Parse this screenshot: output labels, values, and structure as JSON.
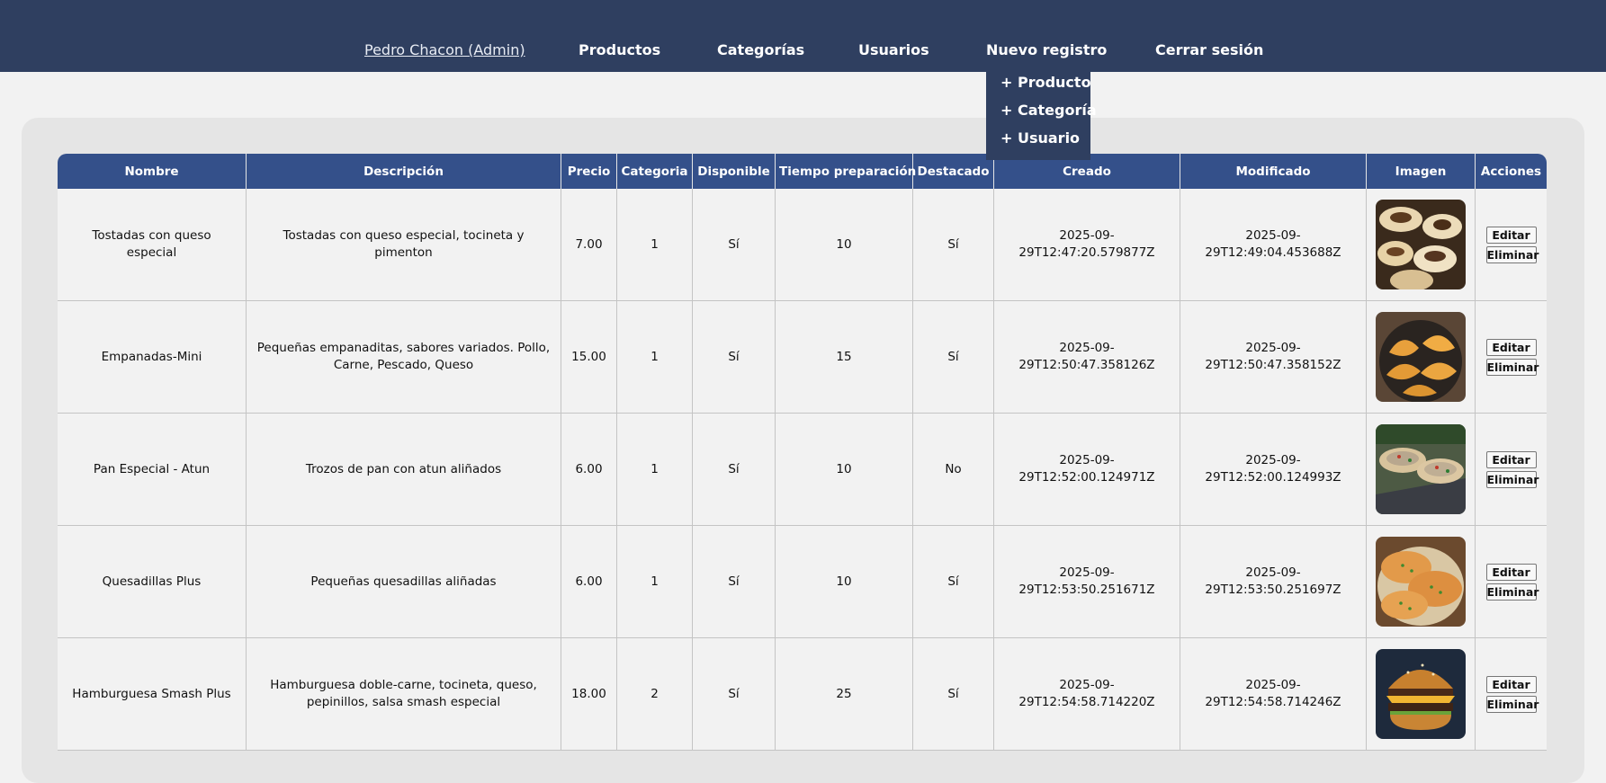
{
  "nav": {
    "user": "Pedro Chacon (Admin)",
    "productos": "Productos",
    "categorias": "Categorías",
    "usuarios": "Usuarios",
    "nuevo_registro": "Nuevo registro",
    "cerrar_sesion": "Cerrar sesión"
  },
  "dropdown": {
    "producto": "+ Producto",
    "categoria": "+ Categoría",
    "usuario": "+ Usuario"
  },
  "table": {
    "headers": [
      "Nombre",
      "Descripción",
      "Precio",
      "Categoria",
      "Disponible",
      "Tiempo preparación",
      "Destacado",
      "Creado",
      "Modificado",
      "Imagen",
      "Acciones"
    ],
    "edit_label": "Editar",
    "delete_label": "Eliminar",
    "rows": [
      {
        "nombre": "Tostadas con queso especial",
        "descripcion": "Tostadas con queso especial, tocineta y pimenton",
        "precio": "7.00",
        "categoria": "1",
        "disponible": "Sí",
        "tiempo": "10",
        "destacado": "Sí",
        "creado": "2025-09-29T12:47:20.579877Z",
        "modificado": "2025-09-29T12:49:04.453688Z",
        "imagen": "tostadas-photo"
      },
      {
        "nombre": "Empanadas-Mini",
        "descripcion": "Pequeñas empanaditas, sabores variados. Pollo, Carne, Pescado, Queso",
        "precio": "15.00",
        "categoria": "1",
        "disponible": "Sí",
        "tiempo": "15",
        "destacado": "Sí",
        "creado": "2025-09-29T12:50:47.358126Z",
        "modificado": "2025-09-29T12:50:47.358152Z",
        "imagen": "empanadas-photo"
      },
      {
        "nombre": "Pan Especial - Atun",
        "descripcion": "Trozos de pan con atun aliñados",
        "precio": "6.00",
        "categoria": "1",
        "disponible": "Sí",
        "tiempo": "10",
        "destacado": "No",
        "creado": "2025-09-29T12:52:00.124971Z",
        "modificado": "2025-09-29T12:52:00.124993Z",
        "imagen": "pan-atun-photo"
      },
      {
        "nombre": "Quesadillas Plus",
        "descripcion": "Pequeñas quesadillas aliñadas",
        "precio": "6.00",
        "categoria": "1",
        "disponible": "Sí",
        "tiempo": "10",
        "destacado": "Sí",
        "creado": "2025-09-29T12:53:50.251671Z",
        "modificado": "2025-09-29T12:53:50.251697Z",
        "imagen": "quesadillas-photo"
      },
      {
        "nombre": "Hamburguesa Smash Plus",
        "descripcion": "Hamburguesa doble-carne, tocineta, queso, pepinillos, salsa smash especial",
        "precio": "18.00",
        "categoria": "2",
        "disponible": "Sí",
        "tiempo": "25",
        "destacado": "Sí",
        "creado": "2025-09-29T12:54:58.714220Z",
        "modificado": "2025-09-29T12:54:58.714246Z",
        "imagen": "hamburguesa-photo"
      }
    ]
  },
  "colors": {
    "navbar": "#2f3f60",
    "table_header": "#34508a",
    "page_bg": "#f2f2f2",
    "panel_bg": "#e5e5e5"
  }
}
